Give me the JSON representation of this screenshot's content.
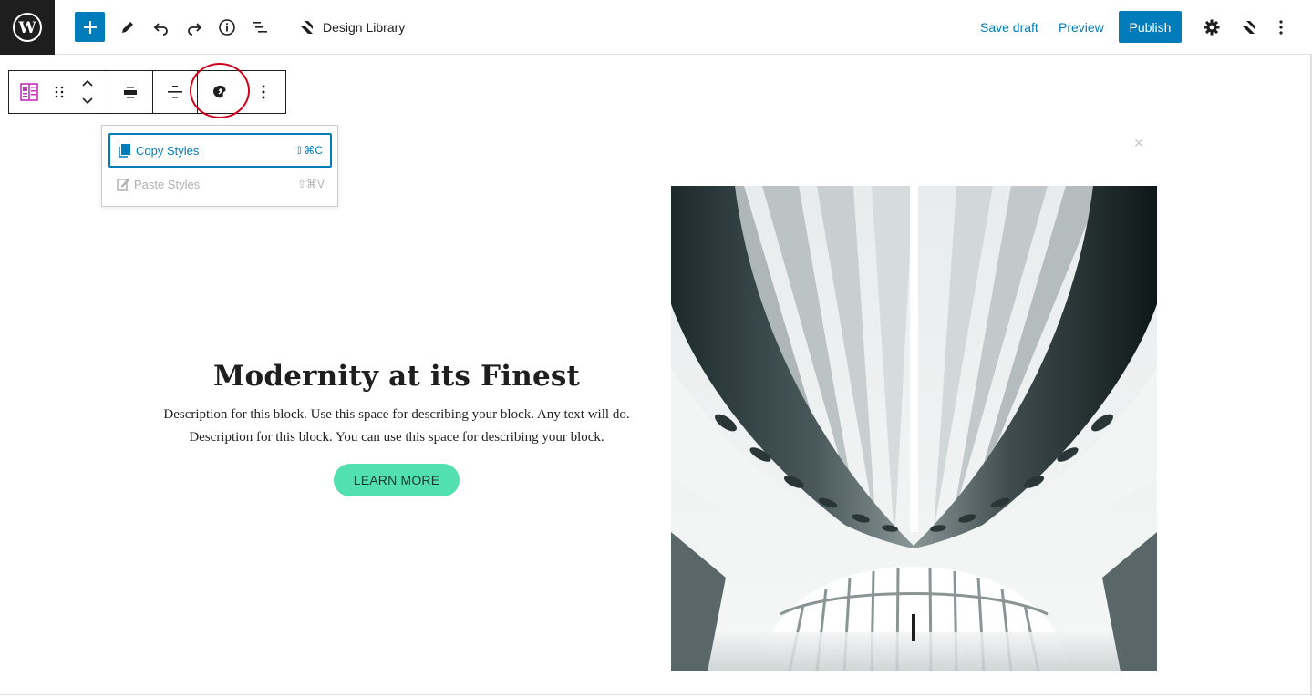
{
  "header": {
    "design_library_label": "Design Library",
    "save_draft_label": "Save draft",
    "preview_label": "Preview",
    "publish_label": "Publish",
    "icons": [
      "wordpress-logo-icon",
      "plus-icon",
      "pencil-icon",
      "undo-icon",
      "redo-icon",
      "info-icon",
      "list-view-icon",
      "stackable-icon",
      "gear-icon",
      "stackable-icon",
      "more-vertical-icon"
    ],
    "accent_color": "#007cba"
  },
  "block_toolbar": {
    "icons": [
      "feature-block-icon",
      "drag-handle-icon",
      "chevron-up-icon",
      "chevron-down-icon",
      "align-center-icon",
      "text-align-icon",
      "paint-palette-icon",
      "more-vertical-icon"
    ]
  },
  "style_menu": {
    "copy_label": "Copy Styles",
    "copy_shortcut": "⇧⌘C",
    "paste_label": "Paste Styles",
    "paste_shortcut": "⇧⌘V"
  },
  "content": {
    "close_glyph": "×",
    "heading": "Modernity at its Finest",
    "description_line1": "Description for this block. Use this space for describing your block. Any text will do.",
    "description_line2": "Description for this block. You can use this space for describing your block.",
    "button_label": "LEARN MORE",
    "button_color": "#52e0b0"
  }
}
